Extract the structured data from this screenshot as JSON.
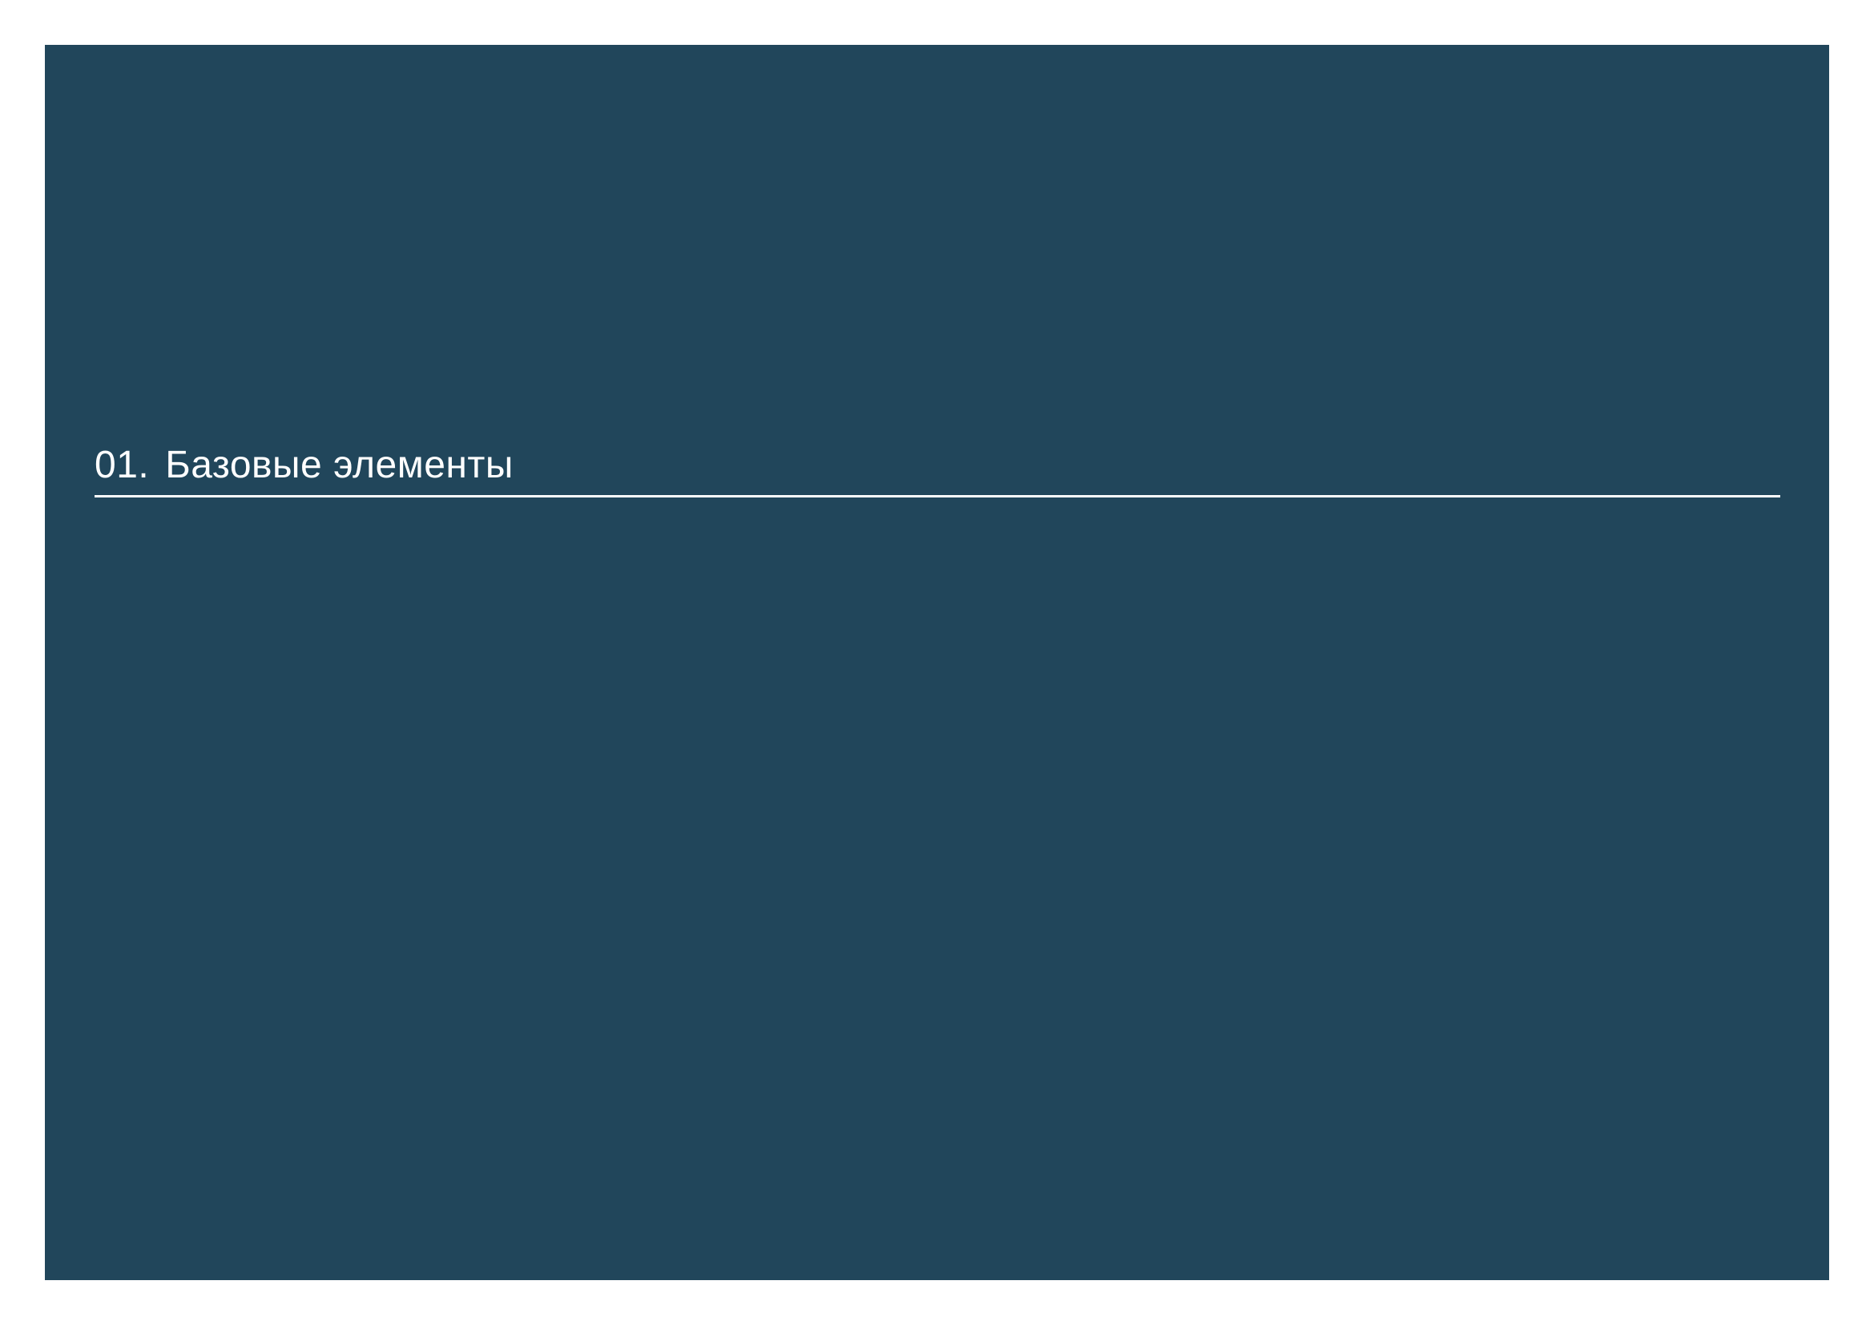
{
  "section": {
    "number": "01.",
    "title": "Базовые элементы"
  },
  "colors": {
    "panel_background": "#21465b",
    "page_background": "#ffffff",
    "text": "#ffffff",
    "rule": "#ffffff"
  }
}
